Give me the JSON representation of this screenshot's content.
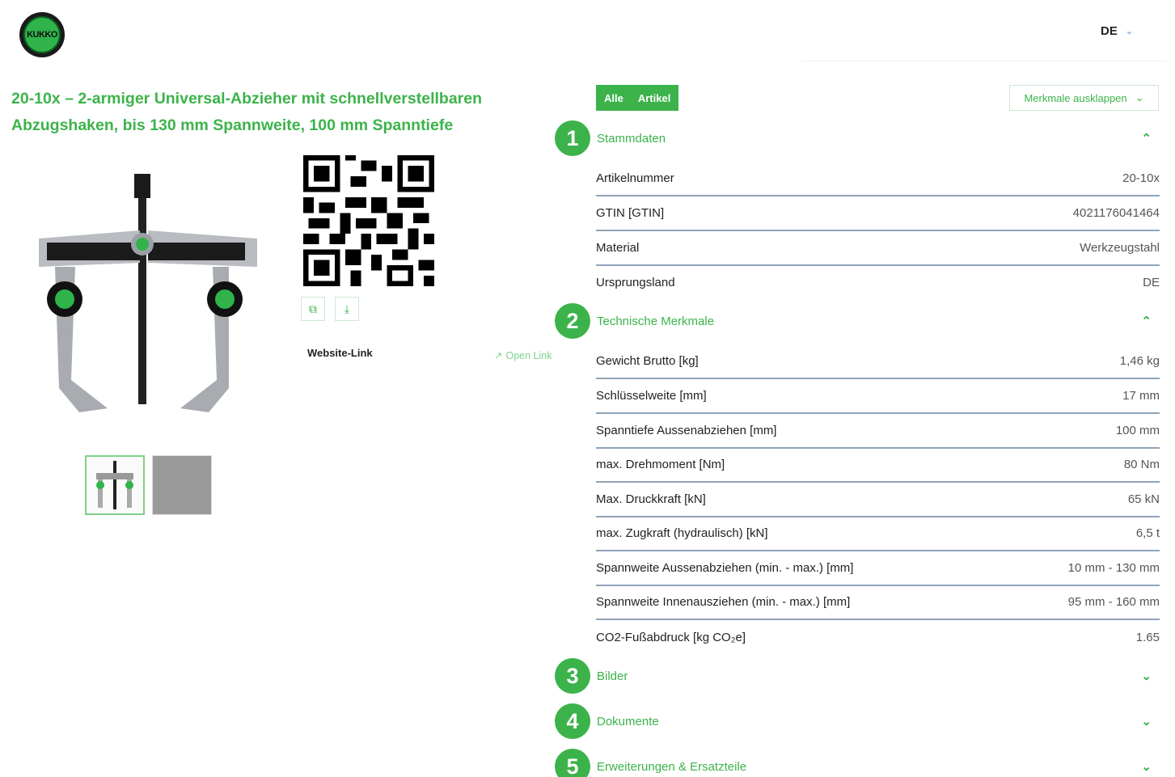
{
  "header": {
    "logo_text": "KUKKO",
    "language": "DE"
  },
  "product": {
    "title": "20-10x – 2-armiger Universal-Abzieher mit schnellverstellbaren Abzugshaken, bis 130 mm Spannweite, 100 mm Spanntiefe"
  },
  "qr": {
    "website_link_label": "Website-Link",
    "open_link_label": "Open Link"
  },
  "filters": {
    "all_label": "Alle",
    "article_label": "Artikel",
    "expand_label": "Merkmale ausklappen"
  },
  "sections": [
    {
      "number": "1",
      "title": "Stammdaten",
      "expanded": true,
      "rows": [
        {
          "key": "Artikelnummer",
          "value": "20-10x"
        },
        {
          "key": "GTIN [GTIN]",
          "value": "4021176041464"
        },
        {
          "key": "Material",
          "value": "Werkzeugstahl"
        },
        {
          "key": "Ursprungsland",
          "value": "DE"
        }
      ]
    },
    {
      "number": "2",
      "title": "Technische Merkmale",
      "expanded": true,
      "rows": [
        {
          "key": "Gewicht Brutto [kg]",
          "value": "1,46 kg"
        },
        {
          "key": "Schlüsselweite [mm]",
          "value": "17 mm"
        },
        {
          "key": "Spanntiefe Aussenabziehen [mm]",
          "value": "100 mm"
        },
        {
          "key": "max. Drehmoment [Nm]",
          "value": "80 Nm"
        },
        {
          "key": "Max. Druckkraft [kN]",
          "value": "65 kN"
        },
        {
          "key": "max. Zugkraft (hydraulisch) [kN]",
          "value": "6,5 t"
        },
        {
          "key": "Spannweite Aussenabziehen (min. - max.) [mm]",
          "value": "10 mm - 130 mm"
        },
        {
          "key": "Spannweite Innenausziehen (min. - max.) [mm]",
          "value": "95 mm - 160 mm"
        },
        {
          "key": "CO2-Fußabdruck [kg CO₂e]",
          "value": "1.65"
        }
      ]
    },
    {
      "number": "3",
      "title": "Bilder",
      "expanded": false
    },
    {
      "number": "4",
      "title": "Dokumente",
      "expanded": false
    },
    {
      "number": "5",
      "title": "Erweiterungen & Ersatzteile",
      "expanded": false
    }
  ],
  "colors": {
    "accent": "#3cb34a",
    "divider": "#8fa3b8"
  }
}
